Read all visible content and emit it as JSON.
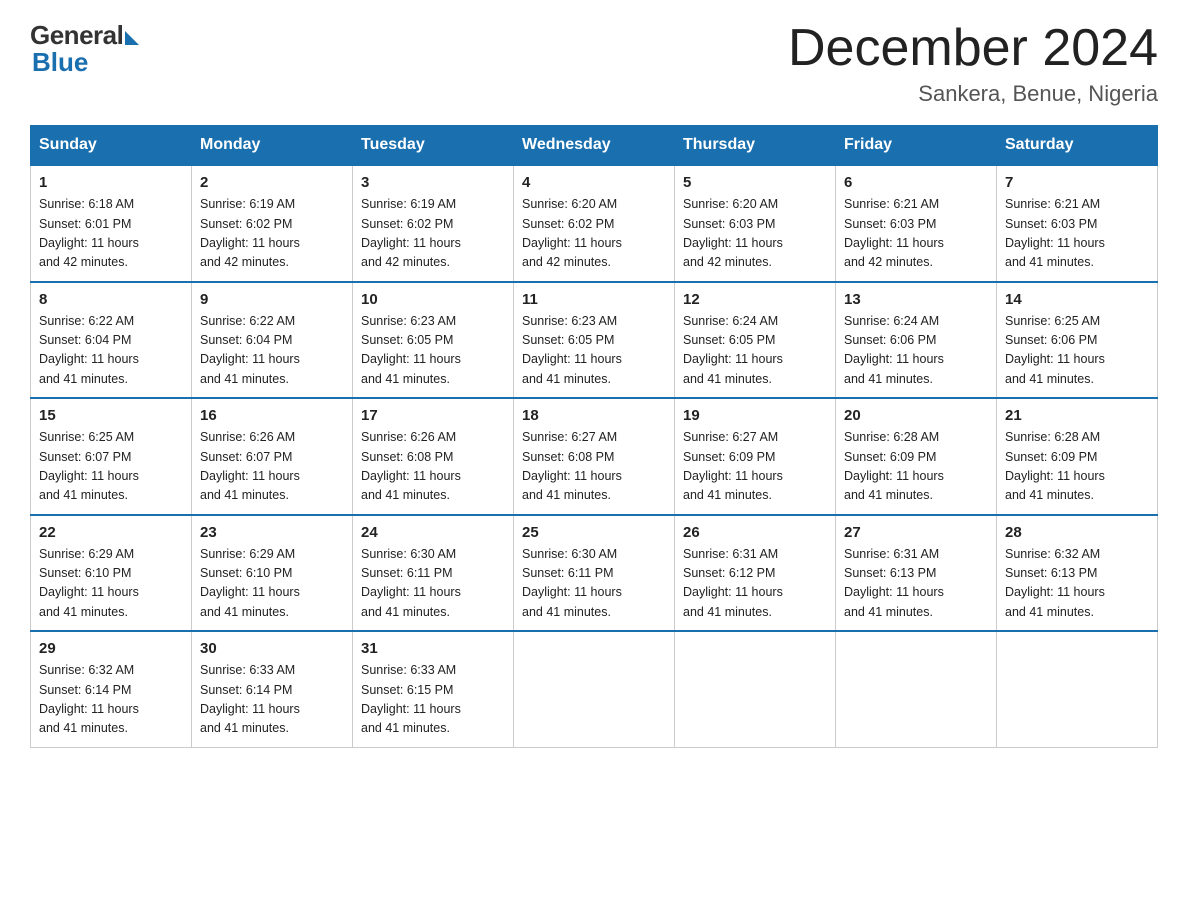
{
  "header": {
    "logo_general": "General",
    "logo_blue": "Blue",
    "month_title": "December 2024",
    "location": "Sankera, Benue, Nigeria"
  },
  "days_of_week": [
    "Sunday",
    "Monday",
    "Tuesday",
    "Wednesday",
    "Thursday",
    "Friday",
    "Saturday"
  ],
  "weeks": [
    [
      {
        "day": "1",
        "sunrise": "6:18 AM",
        "sunset": "6:01 PM",
        "daylight": "11 hours and 42 minutes."
      },
      {
        "day": "2",
        "sunrise": "6:19 AM",
        "sunset": "6:02 PM",
        "daylight": "11 hours and 42 minutes."
      },
      {
        "day": "3",
        "sunrise": "6:19 AM",
        "sunset": "6:02 PM",
        "daylight": "11 hours and 42 minutes."
      },
      {
        "day": "4",
        "sunrise": "6:20 AM",
        "sunset": "6:02 PM",
        "daylight": "11 hours and 42 minutes."
      },
      {
        "day": "5",
        "sunrise": "6:20 AM",
        "sunset": "6:03 PM",
        "daylight": "11 hours and 42 minutes."
      },
      {
        "day": "6",
        "sunrise": "6:21 AM",
        "sunset": "6:03 PM",
        "daylight": "11 hours and 42 minutes."
      },
      {
        "day": "7",
        "sunrise": "6:21 AM",
        "sunset": "6:03 PM",
        "daylight": "11 hours and 41 minutes."
      }
    ],
    [
      {
        "day": "8",
        "sunrise": "6:22 AM",
        "sunset": "6:04 PM",
        "daylight": "11 hours and 41 minutes."
      },
      {
        "day": "9",
        "sunrise": "6:22 AM",
        "sunset": "6:04 PM",
        "daylight": "11 hours and 41 minutes."
      },
      {
        "day": "10",
        "sunrise": "6:23 AM",
        "sunset": "6:05 PM",
        "daylight": "11 hours and 41 minutes."
      },
      {
        "day": "11",
        "sunrise": "6:23 AM",
        "sunset": "6:05 PM",
        "daylight": "11 hours and 41 minutes."
      },
      {
        "day": "12",
        "sunrise": "6:24 AM",
        "sunset": "6:05 PM",
        "daylight": "11 hours and 41 minutes."
      },
      {
        "day": "13",
        "sunrise": "6:24 AM",
        "sunset": "6:06 PM",
        "daylight": "11 hours and 41 minutes."
      },
      {
        "day": "14",
        "sunrise": "6:25 AM",
        "sunset": "6:06 PM",
        "daylight": "11 hours and 41 minutes."
      }
    ],
    [
      {
        "day": "15",
        "sunrise": "6:25 AM",
        "sunset": "6:07 PM",
        "daylight": "11 hours and 41 minutes."
      },
      {
        "day": "16",
        "sunrise": "6:26 AM",
        "sunset": "6:07 PM",
        "daylight": "11 hours and 41 minutes."
      },
      {
        "day": "17",
        "sunrise": "6:26 AM",
        "sunset": "6:08 PM",
        "daylight": "11 hours and 41 minutes."
      },
      {
        "day": "18",
        "sunrise": "6:27 AM",
        "sunset": "6:08 PM",
        "daylight": "11 hours and 41 minutes."
      },
      {
        "day": "19",
        "sunrise": "6:27 AM",
        "sunset": "6:09 PM",
        "daylight": "11 hours and 41 minutes."
      },
      {
        "day": "20",
        "sunrise": "6:28 AM",
        "sunset": "6:09 PM",
        "daylight": "11 hours and 41 minutes."
      },
      {
        "day": "21",
        "sunrise": "6:28 AM",
        "sunset": "6:09 PM",
        "daylight": "11 hours and 41 minutes."
      }
    ],
    [
      {
        "day": "22",
        "sunrise": "6:29 AM",
        "sunset": "6:10 PM",
        "daylight": "11 hours and 41 minutes."
      },
      {
        "day": "23",
        "sunrise": "6:29 AM",
        "sunset": "6:10 PM",
        "daylight": "11 hours and 41 minutes."
      },
      {
        "day": "24",
        "sunrise": "6:30 AM",
        "sunset": "6:11 PM",
        "daylight": "11 hours and 41 minutes."
      },
      {
        "day": "25",
        "sunrise": "6:30 AM",
        "sunset": "6:11 PM",
        "daylight": "11 hours and 41 minutes."
      },
      {
        "day": "26",
        "sunrise": "6:31 AM",
        "sunset": "6:12 PM",
        "daylight": "11 hours and 41 minutes."
      },
      {
        "day": "27",
        "sunrise": "6:31 AM",
        "sunset": "6:13 PM",
        "daylight": "11 hours and 41 minutes."
      },
      {
        "day": "28",
        "sunrise": "6:32 AM",
        "sunset": "6:13 PM",
        "daylight": "11 hours and 41 minutes."
      }
    ],
    [
      {
        "day": "29",
        "sunrise": "6:32 AM",
        "sunset": "6:14 PM",
        "daylight": "11 hours and 41 minutes."
      },
      {
        "day": "30",
        "sunrise": "6:33 AM",
        "sunset": "6:14 PM",
        "daylight": "11 hours and 41 minutes."
      },
      {
        "day": "31",
        "sunrise": "6:33 AM",
        "sunset": "6:15 PM",
        "daylight": "11 hours and 41 minutes."
      },
      null,
      null,
      null,
      null
    ]
  ],
  "labels": {
    "sunrise": "Sunrise:",
    "sunset": "Sunset:",
    "daylight": "Daylight:"
  }
}
